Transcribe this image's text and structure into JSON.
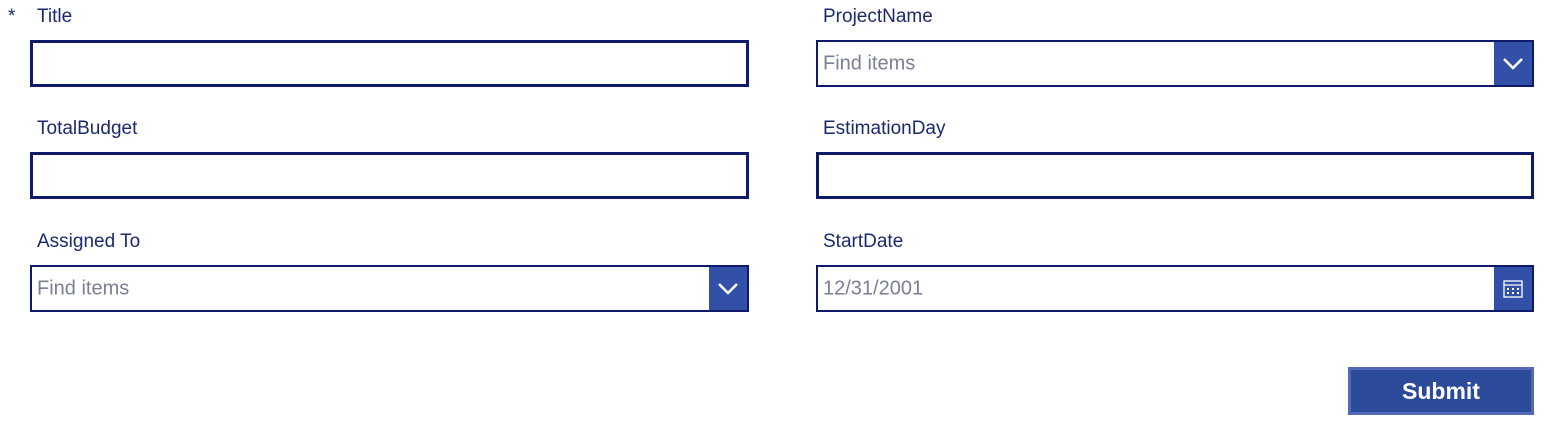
{
  "form": {
    "required_marker": "*",
    "fields": {
      "title": {
        "label": "Title",
        "value": ""
      },
      "project_name": {
        "label": "ProjectName",
        "placeholder": "Find items"
      },
      "total_budget": {
        "label": "TotalBudget",
        "value": ""
      },
      "estimation_day": {
        "label": "EstimationDay",
        "value": ""
      },
      "assigned_to": {
        "label": "Assigned To",
        "placeholder": "Find items"
      },
      "start_date": {
        "label": "StartDate",
        "placeholder": "12/31/2001"
      }
    },
    "submit_label": "Submit"
  },
  "icons": {
    "dropdown": "chevron-down-icon",
    "date_picker": "calendar-icon"
  },
  "colors": {
    "label_text": "#1b2a6b",
    "input_border": "#0f1a6b",
    "accent": "#3250a8",
    "button_bg": "#2c4a9a",
    "placeholder_text": "#7a7f96"
  }
}
